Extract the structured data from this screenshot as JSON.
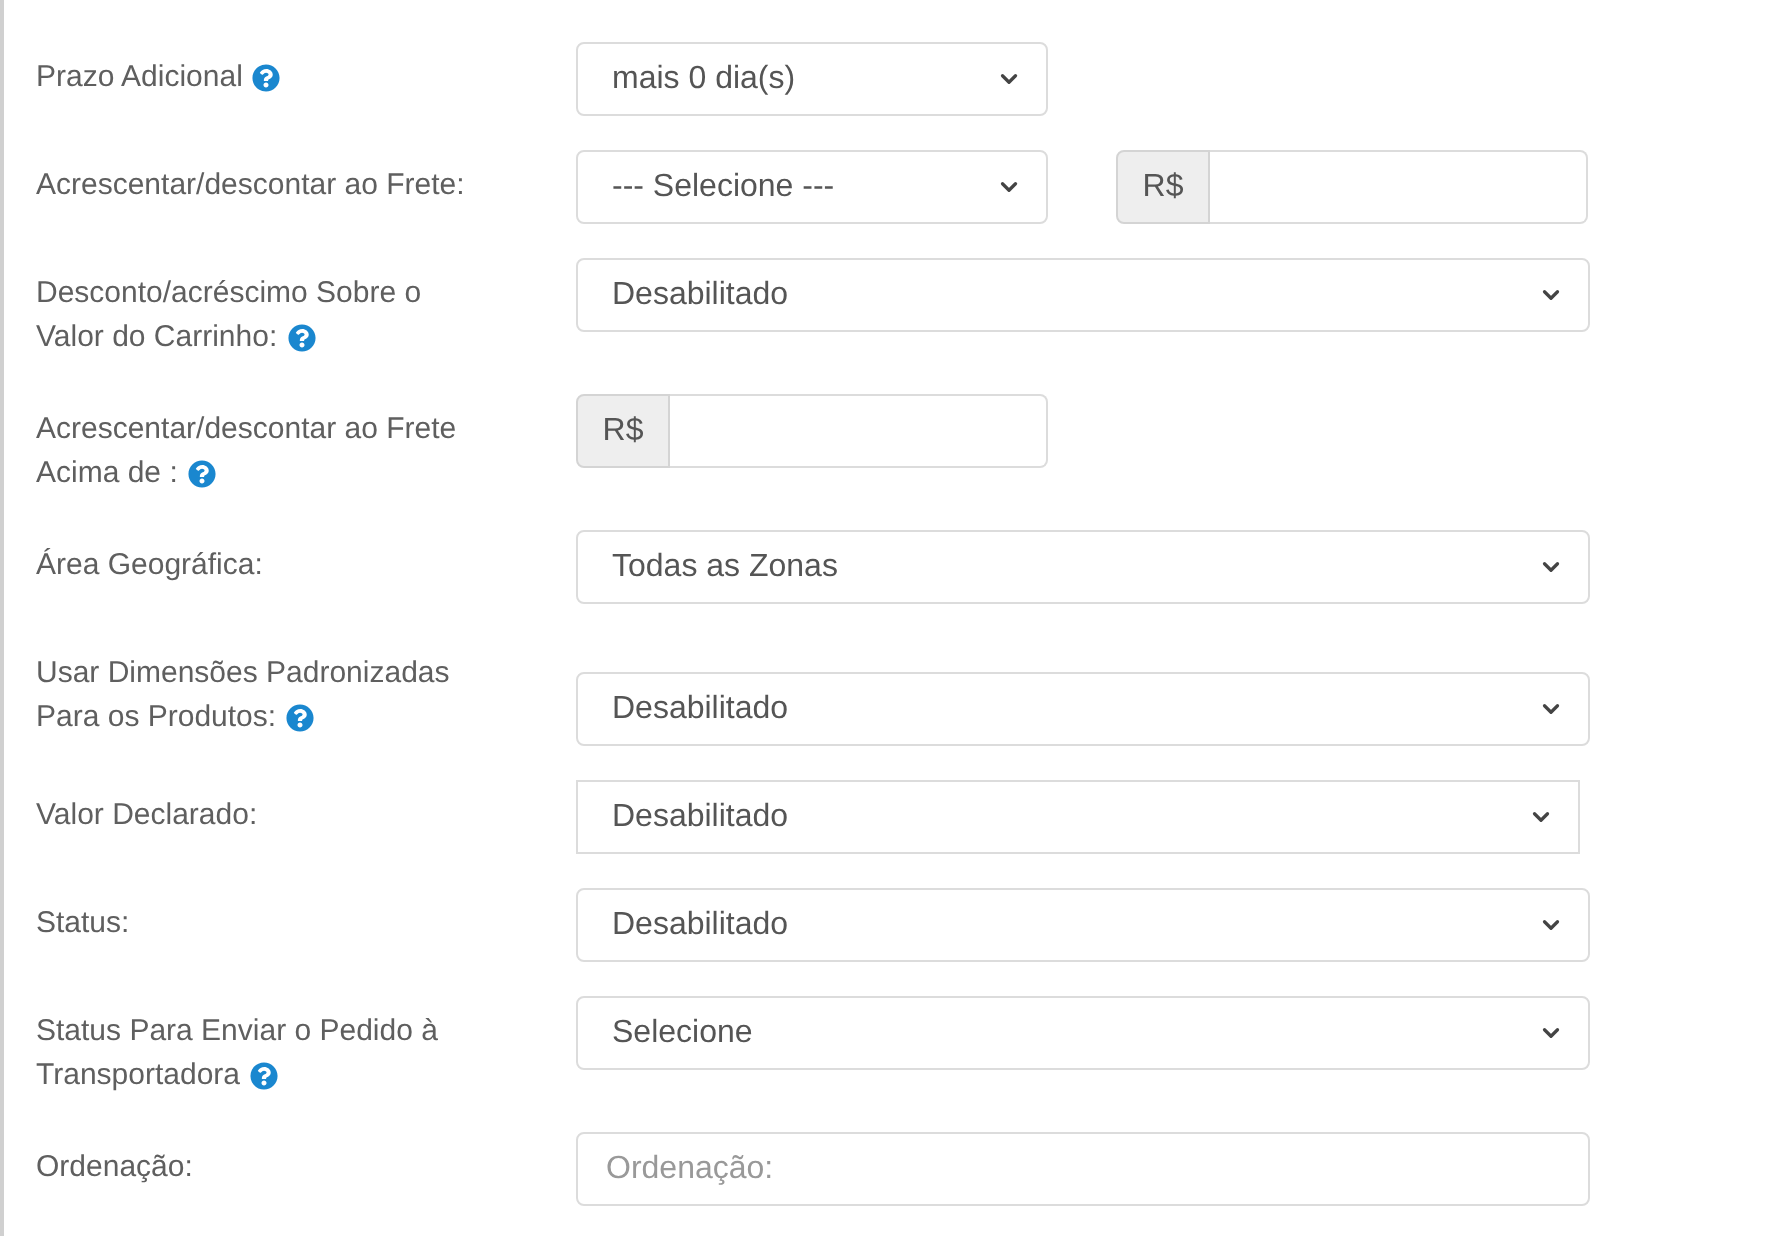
{
  "form": {
    "fields": [
      {
        "lines": [
          "Prazo Adicional"
        ],
        "help": true,
        "controls": [
          {
            "kind": "select",
            "value": "mais 0 dia(s)"
          }
        ]
      },
      {
        "lines": [
          "Acrescentar/descontar ao Frete:"
        ],
        "help": false,
        "controls": [
          {
            "kind": "select",
            "value": "--- Selecione ---"
          },
          {
            "kind": "money",
            "prefix": "R$"
          }
        ]
      },
      {
        "lines": [
          "Desconto/acréscimo Sobre o",
          "Valor do Carrinho:"
        ],
        "help": true,
        "controls": [
          {
            "kind": "select",
            "value": "Desabilitado"
          }
        ]
      },
      {
        "lines": [
          "Acrescentar/descontar ao Frete",
          "Acima de :"
        ],
        "help": true,
        "controls": [
          {
            "kind": "money",
            "prefix": "R$"
          }
        ]
      },
      {
        "lines": [
          "Área Geográfica:"
        ],
        "help": false,
        "controls": [
          {
            "kind": "select",
            "value": "Todas as Zonas"
          }
        ]
      },
      {
        "lines": [
          "Usar Dimensões Padronizadas",
          "Para os Produtos:"
        ],
        "help": true,
        "controls": [
          {
            "kind": "select",
            "value": "Desabilitado"
          }
        ]
      },
      {
        "lines": [
          "Valor Declarado:"
        ],
        "help": false,
        "controls": [
          {
            "kind": "select",
            "value": "Desabilitado"
          }
        ]
      },
      {
        "lines": [
          "Status:"
        ],
        "help": false,
        "controls": [
          {
            "kind": "select",
            "value": "Desabilitado"
          }
        ]
      },
      {
        "lines": [
          "Status Para Enviar o Pedido à",
          "Transportadora"
        ],
        "help": true,
        "controls": [
          {
            "kind": "select",
            "value": "Selecione"
          }
        ]
      },
      {
        "lines": [
          "Ordenação:"
        ],
        "help": false,
        "controls": [
          {
            "kind": "text",
            "placeholder": "Ordenação:"
          }
        ]
      }
    ]
  }
}
